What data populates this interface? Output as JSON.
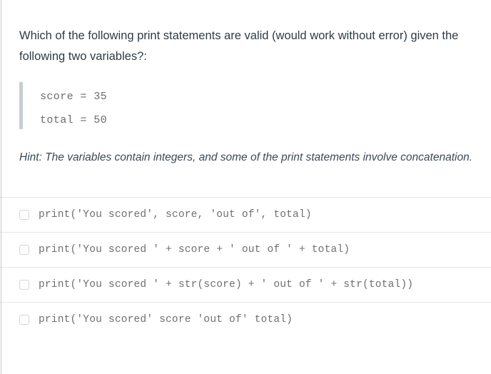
{
  "question": {
    "prompt": "Which of the following print statements are valid (would work without error) given the following two variables?:",
    "code_sample": {
      "lines": [
        "score = 35",
        "total = 50"
      ]
    },
    "hint": {
      "label": "Hint:",
      "text": "The variables contain integers, and some of the print statements involve concatenation.",
      "full": "Hint:  The variables contain integers, and some of the print statements involve concatenation."
    }
  },
  "answers": {
    "options": [
      {
        "label": "print('You scored', score, 'out of', total)",
        "checked": false
      },
      {
        "label": "print('You scored ' + score + ' out of ' + total)",
        "checked": false
      },
      {
        "label": "print('You scored ' + str(score) + ' out of ' + str(total))",
        "checked": false
      },
      {
        "label": "print('You scored' score 'out of' total)",
        "checked": false
      }
    ]
  },
  "colors": {
    "text": "#2d3b45",
    "code_text": "#6b6b6b",
    "option_text": "#6f6f6f",
    "accent_bar": "#c7cdd1",
    "divider": "#e3e5e7",
    "checkbox_border": "#d4d6d8",
    "page_edge": "#c7c7c7",
    "background": "#ffffff"
  }
}
